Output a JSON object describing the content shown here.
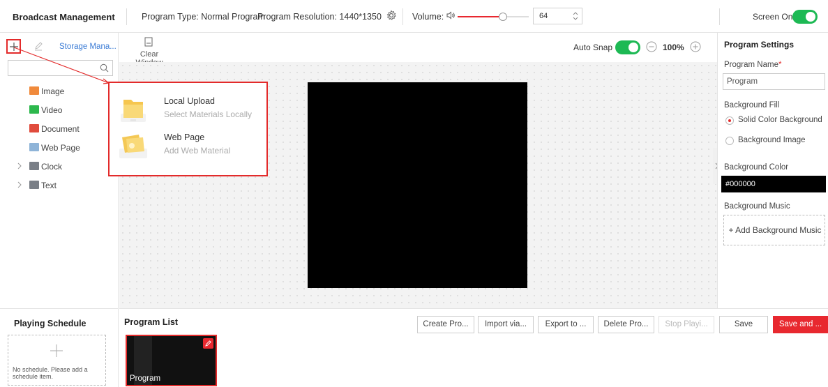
{
  "header": {
    "title": "Broadcast Management",
    "program_type": "Program Type: Normal Program",
    "program_resolution": "Program Resolution: 1440*1350",
    "volume_label": "Volume:",
    "volume_value": "64",
    "volume_fraction": 0.64,
    "screen_on_label": "Screen On",
    "screen_on": true
  },
  "left_panel": {
    "storage_link": "Storage Mana...",
    "search_placeholder": "",
    "tree": [
      {
        "label": "Image",
        "icon": "image-icon",
        "color": "#f08a3c",
        "expandable": false
      },
      {
        "label": "Video",
        "icon": "video-icon",
        "color": "#2db84d",
        "expandable": false
      },
      {
        "label": "Document",
        "icon": "pdf-icon",
        "color": "#e04b3c",
        "expandable": false
      },
      {
        "label": "Web Page",
        "icon": "web-page-icon",
        "color": "#8fb4d8",
        "expandable": false
      },
      {
        "label": "Clock",
        "icon": "clock-icon",
        "color": "#7a7f87",
        "expandable": true
      },
      {
        "label": "Text",
        "icon": "text-icon",
        "color": "#7a7f87",
        "expandable": true
      }
    ]
  },
  "add_popup": {
    "items": [
      {
        "title": "Local Upload",
        "subtitle": "Select Materials Locally",
        "icon": "folder-icon"
      },
      {
        "title": "Web Page",
        "subtitle": "Add Web Material",
        "icon": "web-material-icon"
      }
    ]
  },
  "toolbar": {
    "clear_window": "Clear Window",
    "auto_snap": "Auto Snap",
    "auto_snap_on": true,
    "zoom": "100%"
  },
  "settings": {
    "title": "Program Settings",
    "program_name_label": "Program Name",
    "required_mark": "*",
    "program_name_value": "Program",
    "background_fill_label": "Background Fill",
    "fill_options": [
      "Solid Color Background",
      "Background Image"
    ],
    "fill_selected": 0,
    "background_color_label": "Background Color",
    "background_color_value": "#000000",
    "background_music_label": "Background Music",
    "add_music": "+ Add Background Music"
  },
  "schedule": {
    "title": "Playing Schedule",
    "empty_text": "No schedule. Please add a schedule item."
  },
  "program_list": {
    "title": "Program List",
    "buttons": {
      "create": "Create Pro...",
      "import": "Import via...",
      "export": "Export to ...",
      "delete": "Delete Pro...",
      "stop": "Stop Playi...",
      "save": "Save",
      "save_and": "Save and ..."
    },
    "programs": [
      {
        "name": "Program"
      }
    ]
  },
  "colors": {
    "accent": "#e8282f",
    "toggle_on": "#1db954",
    "link": "#3a7bd5"
  }
}
